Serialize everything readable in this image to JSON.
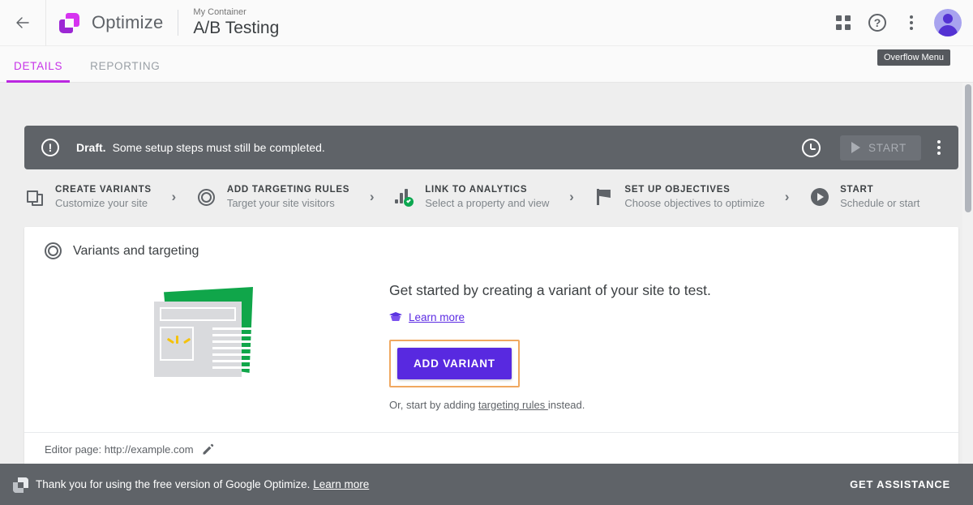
{
  "header": {
    "back_icon": "back-arrow-icon",
    "brand": "Optimize",
    "container_label": "My Container",
    "page_title": "A/B Testing",
    "apps_icon": "apps-grid-icon",
    "help_icon": "help-icon",
    "help_glyph": "?",
    "overflow_icon": "overflow-menu-icon",
    "avatar_icon": "avatar-icon"
  },
  "tooltip": {
    "text": "Overflow Menu"
  },
  "tabs": [
    {
      "label": "DETAILS",
      "active": true
    },
    {
      "label": "REPORTING",
      "active": false
    }
  ],
  "banner": {
    "alert_glyph": "!",
    "status": "Draft.",
    "message": "Some setup steps must still be completed.",
    "clock_icon": "schedule-clock-icon",
    "start_label": "START",
    "start_enabled": false,
    "kebab_icon": "banner-overflow-icon",
    "bg_color": "#5f6368"
  },
  "stepper": {
    "chevron": "›",
    "steps": [
      {
        "icon": "layers-icon",
        "title": "CREATE VARIANTS",
        "subtitle": "Customize your site",
        "complete": false
      },
      {
        "icon": "target-icon",
        "title": "ADD TARGETING RULES",
        "subtitle": "Target your site visitors",
        "complete": false
      },
      {
        "icon": "analytics-bars-icon",
        "title": "LINK TO ANALYTICS",
        "subtitle": "Select a property and view",
        "complete": true
      },
      {
        "icon": "flag-icon",
        "title": "SET UP OBJECTIVES",
        "subtitle": "Choose objectives to optimize",
        "complete": false
      },
      {
        "icon": "play-circle-icon",
        "title": "START",
        "subtitle": "Schedule or start",
        "complete": false
      }
    ]
  },
  "card": {
    "header_icon": "target-icon",
    "header_title": "Variants and targeting",
    "illustration": "create-variant-illustration",
    "headline": "Get started by creating a variant of your site to test.",
    "learn_icon": "graduation-cap-icon",
    "learn_more": "Learn more",
    "primary_button": "ADD VARIANT",
    "primary_button_color": "#5829e0",
    "highlight_color": "#f0a860",
    "alt_prefix": "Or, start by adding ",
    "alt_link": "targeting rules ",
    "alt_suffix": "instead.",
    "footer_label": "Editor page: http://example.com",
    "edit_icon": "pencil-icon"
  },
  "bottom_bar": {
    "logo_icon": "optimize-logo-icon",
    "message": "Thank you for using the free version of Google Optimize. ",
    "learn_more": "Learn more",
    "action": "GET ASSISTANCE",
    "bg_color": "#5f6368"
  }
}
